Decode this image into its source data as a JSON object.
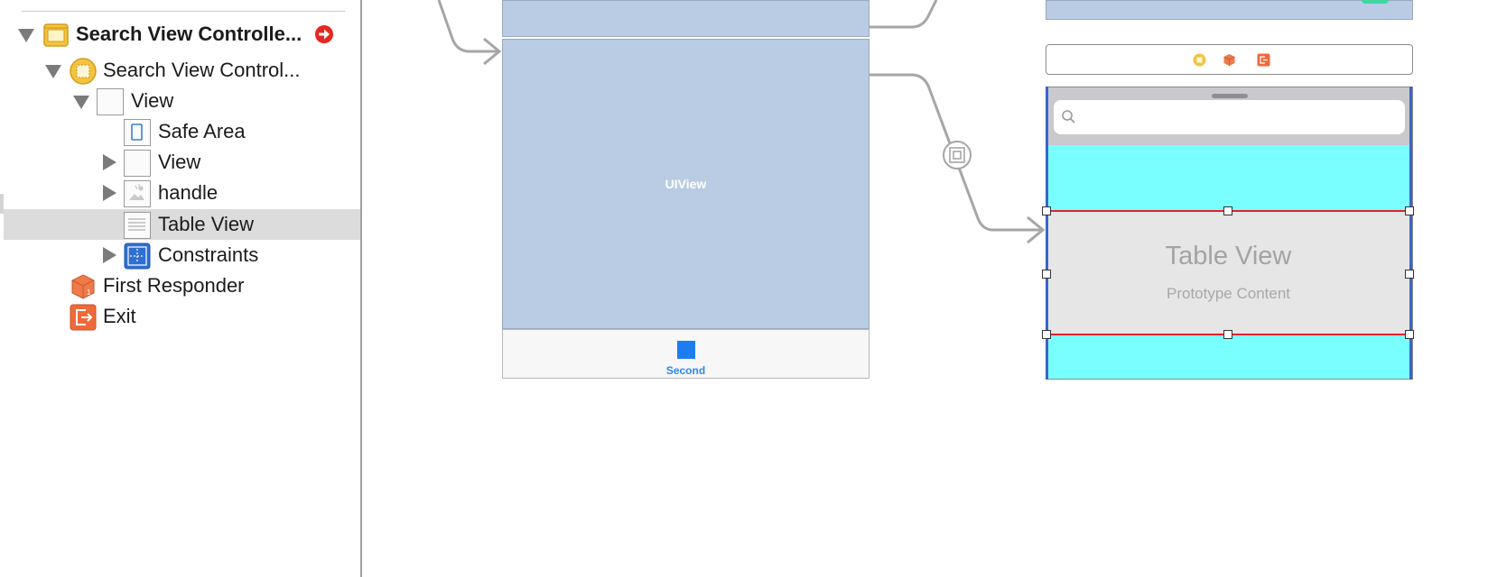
{
  "outline": {
    "items": [
      {
        "label": "Search View Controlle...",
        "name": "outline-scene-search-view-controller"
      },
      {
        "label": "Search View Control...",
        "name": "outline-search-view-controller"
      },
      {
        "label": "View",
        "name": "outline-view"
      },
      {
        "label": "Safe Area",
        "name": "outline-safe-area"
      },
      {
        "label": "View",
        "name": "outline-subview"
      },
      {
        "label": "handle",
        "name": "outline-handle"
      },
      {
        "label": "Table View",
        "name": "outline-table-view"
      },
      {
        "label": "Constraints",
        "name": "outline-constraints"
      },
      {
        "label": "First Responder",
        "name": "outline-first-responder"
      },
      {
        "label": "Exit",
        "name": "outline-exit"
      }
    ],
    "selected_index": 6
  },
  "canvas": {
    "uiview_label": "UIView",
    "tab_item_label": "Second",
    "table_view_title": "Table View",
    "table_view_subtitle": "Prototype Content",
    "colors": {
      "panel_blue": "#b9cce4",
      "cyan_bg": "#7affff",
      "tab_blue": "#1e7cf3",
      "selection_red": "#e4202b",
      "warning_red": "#e8261f"
    }
  }
}
